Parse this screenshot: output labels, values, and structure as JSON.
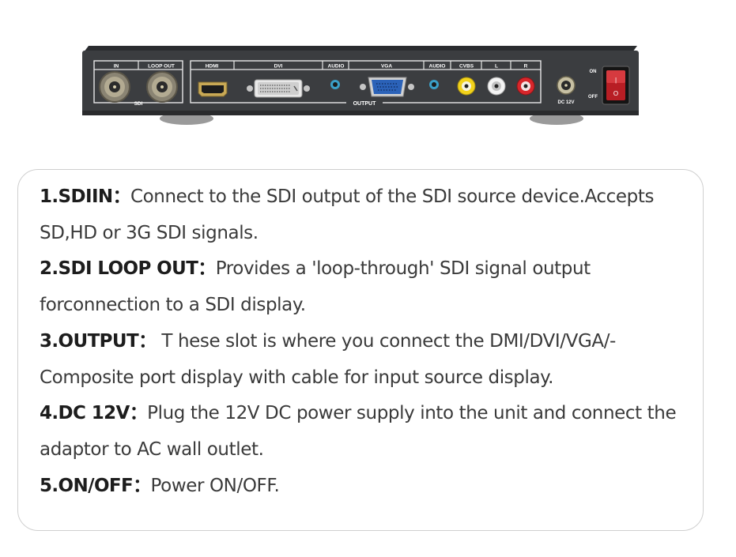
{
  "device": {
    "sdi_group": {
      "in_label": "IN",
      "loop_out_label": "LOOP OUT",
      "sdi_label": "SDI"
    },
    "output_group": {
      "hdmi_label": "HDMI",
      "dvi_label": "DVI",
      "audio1_label": "AUDIO",
      "vga_label": "VGA",
      "audio2_label": "AUDIO",
      "cvbs_label": "CVBS",
      "l_label": "L",
      "r_label": "R",
      "output_label": "OUTPUT"
    },
    "power": {
      "dc_label": "DC 12V",
      "on_label": "ON",
      "off_label": "OFF",
      "switch_on_glyph": "|",
      "switch_off_glyph": "O"
    },
    "colors": {
      "chassis": "#3b3d40",
      "cvbs_jack": "#f2d21b",
      "l_jack": "#f4f4f4",
      "r_jack": "#d8262b",
      "vga_connector": "#2b62b8",
      "audio_jack": "#3aa0c8",
      "power_switch": "#b81e24"
    }
  },
  "description": {
    "items": [
      {
        "key": "1.SDIIN：",
        "text": "Connect to the SDI output of the SDI source device.Accepts SD,HD or  3G SDI signals."
      },
      {
        "key": "2.SDI LOOP OUT：",
        "text": "Provides a 'loop-through' SDI signal output forconnection to a SDI display."
      },
      {
        "key": "3.OUTPUT：",
        "text": " T hese slot is where you connect the DMI/DVI/VGA/-Composite port display with cable for input source display."
      },
      {
        "key": "4.DC 12V：",
        "text": "Plug the 12V DC power supply into the unit and connect the adaptor to AC wall outlet."
      },
      {
        "key": "5.ON/OFF：",
        "text": "Power ON/OFF."
      }
    ]
  }
}
